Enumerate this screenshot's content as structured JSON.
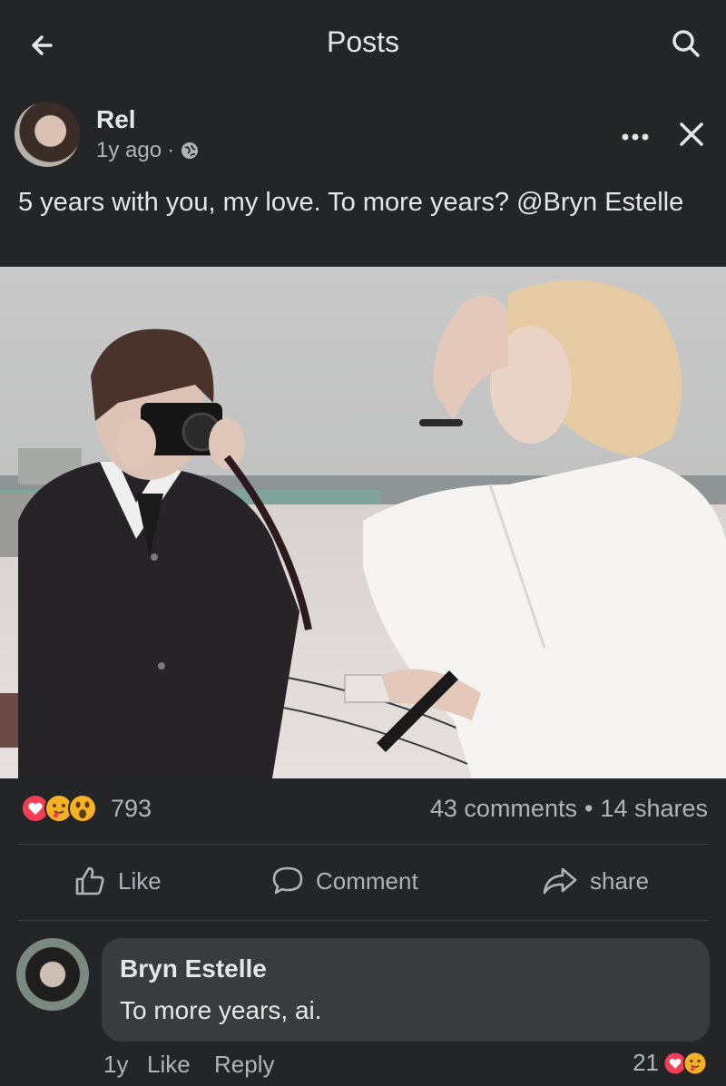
{
  "topbar": {
    "title": "Posts",
    "back_icon": "arrow-left-icon",
    "search_icon": "search-icon"
  },
  "post": {
    "author": "Rel",
    "time": "1y ago",
    "separator": "·",
    "audience_icon": "globe-icon",
    "more_icon": "more-icon",
    "close_icon": "close-icon",
    "text": "5 years with you, my love. To more years? @Bryn Estelle",
    "photo_alt": "",
    "reactions": {
      "icons": [
        "heart",
        "hug",
        "wow"
      ],
      "count": "793"
    },
    "comments_count": "43 comments",
    "dot": "•",
    "shares_count": "14 shares"
  },
  "actions": {
    "like": "Like",
    "comment": "Comment",
    "share": "share"
  },
  "comment": {
    "author": "Bryn Estelle",
    "text": "To more years, ai.",
    "time": "1y",
    "like": "Like",
    "reply": "Reply",
    "reaction_count": "21"
  },
  "colors": {
    "background": "#242526",
    "text": "#e4e6eb",
    "secondary_text": "#b0b3b8",
    "bubble": "#3a3b3c",
    "heart": "#f33e58",
    "emoji": "#f7b125"
  }
}
